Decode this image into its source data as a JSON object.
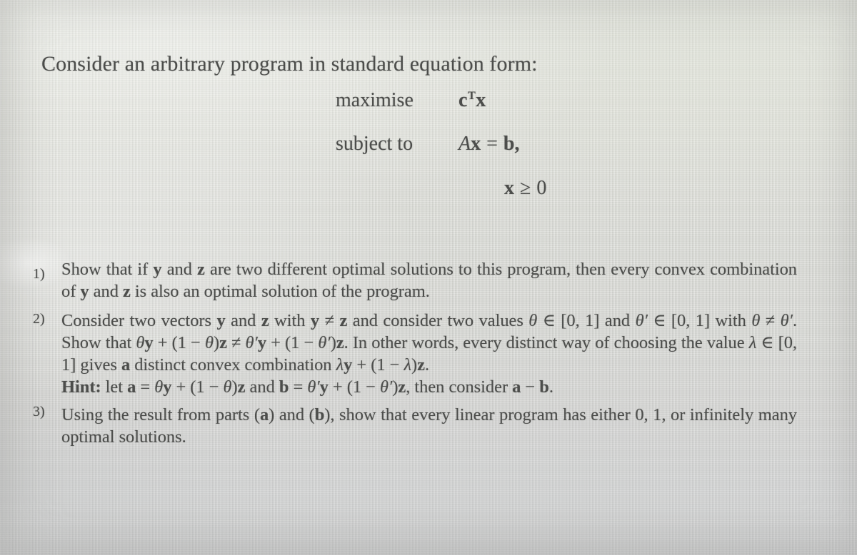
{
  "document": {
    "lead_text": "Consider an arbitrary program in standard equation form:",
    "program": {
      "rows": [
        {
          "keyword": "maximise",
          "expression": "cᵀx"
        },
        {
          "keyword": "subject to",
          "expression": "Ax = b,"
        },
        {
          "keyword": "",
          "expression": "x ≥ 0"
        }
      ],
      "objective_keyword": "maximise",
      "objective_vector": "c",
      "objective_transpose": "T",
      "objective_variable": "x",
      "constraint_keyword": "subject to",
      "constraint_matrix": "A",
      "constraint_variable": "x",
      "constraint_equals": "=",
      "constraint_rhs": "b,",
      "nonneg_variable": "x",
      "nonneg_relation": "≥",
      "nonneg_bound": "0"
    },
    "questions": [
      {
        "number": "1)",
        "text": "Show that if y and z are two different optimal solutions to this program, then every convex combination of y and z is also an optimal solution of the program.",
        "segments": [
          {
            "t": "Show that if ",
            "style": "normal"
          },
          {
            "t": "y",
            "style": "bold"
          },
          {
            "t": " and ",
            "style": "normal"
          },
          {
            "t": "z",
            "style": "bold"
          },
          {
            "t": " are two different optimal solutions to this program, then every convex combination of ",
            "style": "normal"
          },
          {
            "t": "y",
            "style": "bold"
          },
          {
            "t": " and ",
            "style": "normal"
          },
          {
            "t": "z",
            "style": "bold"
          },
          {
            "t": " is also an optimal solution of the program.",
            "style": "normal"
          }
        ]
      },
      {
        "number": "2)",
        "text": "Consider two vectors y and z with y ≠ z and consider two values θ ∈ [0, 1] and θ′ ∈ [0, 1] with θ ≠ θ′. Show that θy + (1 − θ)z ≠ θ′y + (1 − θ′)z. In other words, every distinct way of choosing the value λ ∈ [0, 1] gives a distinct convex combination λy + (1 − λ)z.",
        "hint": "Hint: let a = θy + (1 − θ)z and b = θ′y + (1 − θ′)z, then consider a − b.",
        "hint_label": "Hint:"
      },
      {
        "number": "3)",
        "text": "Using the result from parts (a) and (b), show that every linear program has either 0, 1, or infinitely many optimal solutions."
      }
    ]
  },
  "colors": {
    "paper_top": "#e3e5dd",
    "paper_bottom": "#d1d2d2",
    "ink": "#4c4d4b"
  }
}
